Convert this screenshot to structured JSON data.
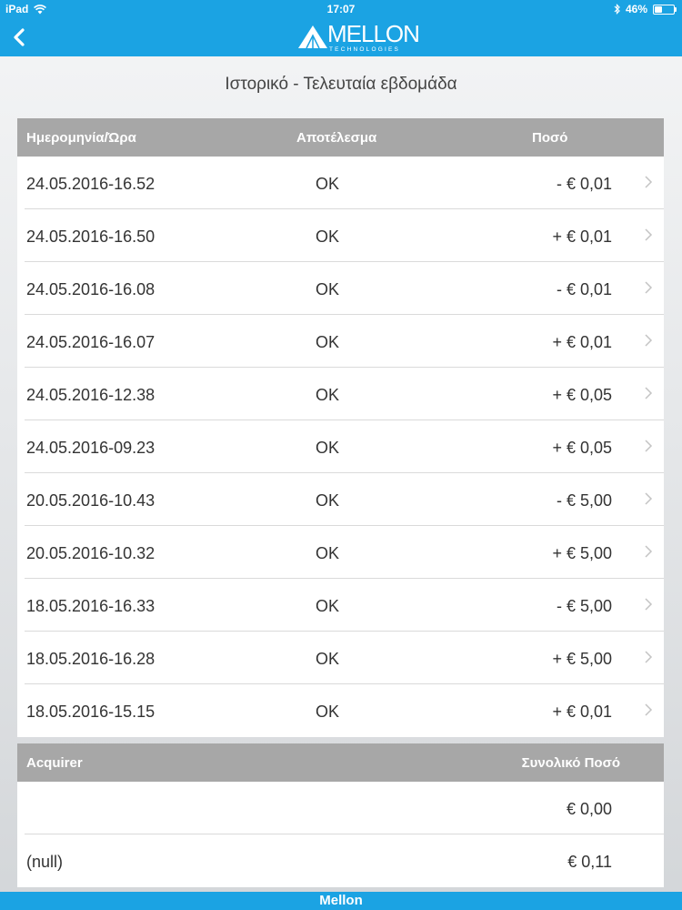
{
  "status_bar": {
    "device": "iPad",
    "time": "17:07",
    "battery": "46%",
    "battery_level": 0.46
  },
  "nav": {
    "logo_text": "MELLON",
    "logo_sub": "TECHNOLOGIES"
  },
  "page_title": "Ιστορικό - Τελευταία εβδομάδα",
  "history": {
    "headers": [
      "Ημερομηνία/Ώρα",
      "Αποτέλεσμα",
      "Ποσό"
    ],
    "rows": [
      {
        "date": "24.05.2016-16.52",
        "result": "OK",
        "amount": "- € 0,01"
      },
      {
        "date": "24.05.2016-16.50",
        "result": "OK",
        "amount": "+ € 0,01"
      },
      {
        "date": "24.05.2016-16.08",
        "result": "OK",
        "amount": "- € 0,01"
      },
      {
        "date": "24.05.2016-16.07",
        "result": "OK",
        "amount": "+ € 0,01"
      },
      {
        "date": "24.05.2016-12.38",
        "result": "OK",
        "amount": "+ € 0,05"
      },
      {
        "date": "24.05.2016-09.23",
        "result": "OK",
        "amount": "+ € 0,05"
      },
      {
        "date": "20.05.2016-10.43",
        "result": "OK",
        "amount": "- € 5,00"
      },
      {
        "date": "20.05.2016-10.32",
        "result": "OK",
        "amount": "+ € 5,00"
      },
      {
        "date": "18.05.2016-16.33",
        "result": "OK",
        "amount": "- € 5,00"
      },
      {
        "date": "18.05.2016-16.28",
        "result": "OK",
        "amount": "+ € 5,00"
      },
      {
        "date": "18.05.2016-15.15",
        "result": "OK",
        "amount": "+ € 0,01"
      }
    ]
  },
  "summary": {
    "headers": [
      "Acquirer",
      "Συνολικό Ποσό"
    ],
    "rows": [
      {
        "acquirer": "",
        "total": "€ 0,00"
      },
      {
        "acquirer": "(null)",
        "total": "€ 0,11"
      }
    ]
  },
  "bottom_bar": {
    "label": "Mellon"
  },
  "colors": {
    "accent": "#1ba3e3",
    "header_gray": "#a7a7a7"
  }
}
